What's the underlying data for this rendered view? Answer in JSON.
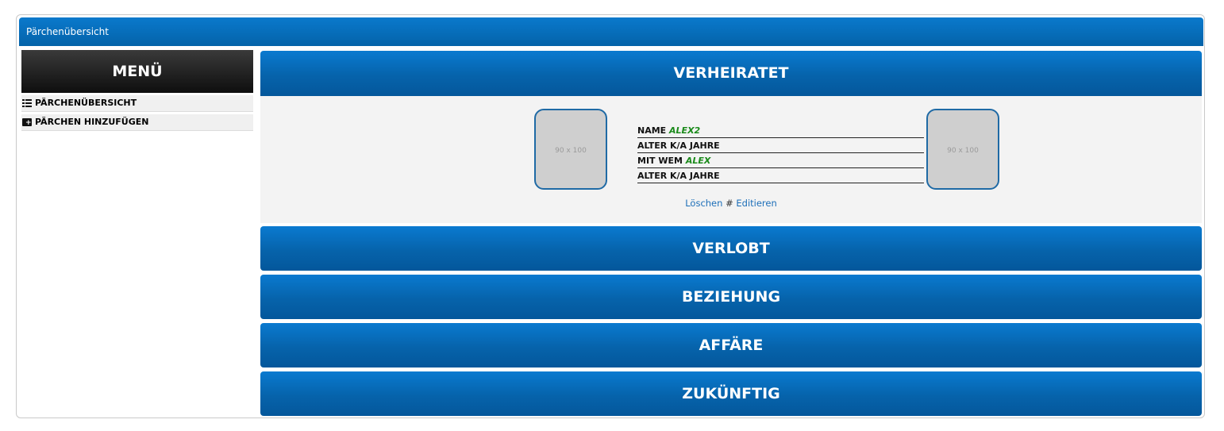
{
  "window": {
    "title": "Pärchenübersicht"
  },
  "menu": {
    "heading": "MENÜ",
    "items": [
      {
        "label": "PÄRCHENÜBERSICHT",
        "icon": "list-icon"
      },
      {
        "label": "PÄRCHEN HINZUFÜGEN",
        "icon": "folder-add-icon"
      }
    ]
  },
  "sections": {
    "verheiratet": "VERHEIRATET",
    "verlobt": "VERLOBT",
    "beziehung": "BEZIEHUNG",
    "affaere": "AFFÄRE",
    "zukuenftig": "ZUKÜNFTIG"
  },
  "couple": {
    "photo_left": "90 x 100",
    "photo_right": "90 x 100",
    "name_label": "NAME",
    "name_value": "ALEX2",
    "age1": "ALTER K/A JAHRE",
    "partner_label": "MIT WEM",
    "partner_value": "ALEX",
    "age2": "ALTER K/A JAHRE",
    "delete_link": "Löschen",
    "separator": "#",
    "edit_link": "Editieren"
  },
  "colors": {
    "accent": "#0663ab",
    "name_value": "#1a8a1a",
    "link": "#1c6eb8"
  }
}
